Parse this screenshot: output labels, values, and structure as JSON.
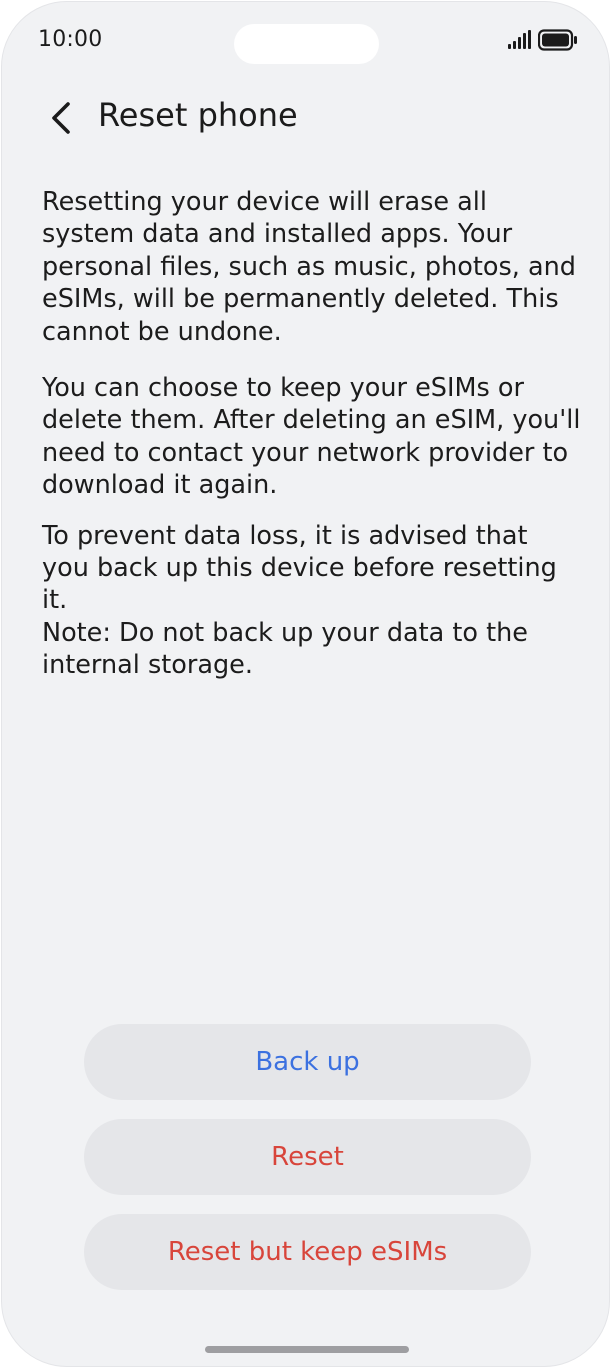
{
  "status_bar": {
    "time": "10:00",
    "icons": [
      "signal-icon",
      "battery-icon"
    ]
  },
  "header": {
    "back_icon": "chevron-left-icon",
    "title": "Reset phone"
  },
  "body": {
    "paragraph_1": "Resetting your device will erase all system data and installed apps. Your personal files, such as music, photos, and eSIMs, will be permanently deleted. This cannot be undone.",
    "paragraph_2": "You can choose to keep your eSIMs or delete them. After deleting an eSIM, you'll need to contact your network provider to download it again.",
    "paragraph_3": "To prevent data loss, it is advised that you back up this device before resetting it.",
    "paragraph_4": "Note: Do not back up your data to the internal storage."
  },
  "actions": {
    "back_up_label": "Back up",
    "reset_label": "Reset",
    "reset_keep_esims_label": "Reset but keep eSIMs"
  },
  "colors": {
    "background": "#f1f2f4",
    "button_background": "#e5e6e9",
    "primary_action": "#3c71e0",
    "destructive_action": "#d8453b",
    "text": "#1c1c1c"
  }
}
